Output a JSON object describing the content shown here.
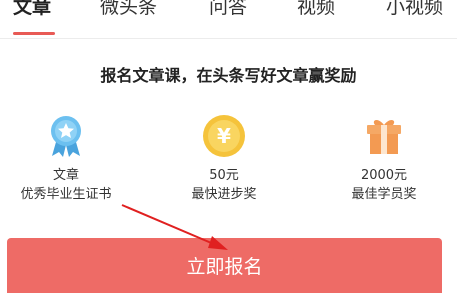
{
  "tabs": [
    {
      "label": "文章",
      "active": true
    },
    {
      "label": "微头条",
      "active": false
    },
    {
      "label": "问答",
      "active": false
    },
    {
      "label": "视频",
      "active": false
    },
    {
      "label": "小视频",
      "active": false
    }
  ],
  "headline": "报名文章课，在头条写好文章赢奖励",
  "rewards": [
    {
      "line1": "文章",
      "line2": "优秀毕业生证书",
      "icon": "medal-star-icon"
    },
    {
      "line1": "50元",
      "line2": "最快进步奖",
      "icon": "yuan-coin-icon"
    },
    {
      "line1": "2000元",
      "line2": "最佳学员奖",
      "icon": "gift-box-icon"
    }
  ],
  "signup_button": {
    "label": "立即报名"
  },
  "colors": {
    "accent": "#ee6b66",
    "tab_underline": "#e85a55",
    "annotation_arrow": "#e02020",
    "coin": "#f5c33b",
    "gift": "#f39a52",
    "medal": "#5fb6ea"
  }
}
